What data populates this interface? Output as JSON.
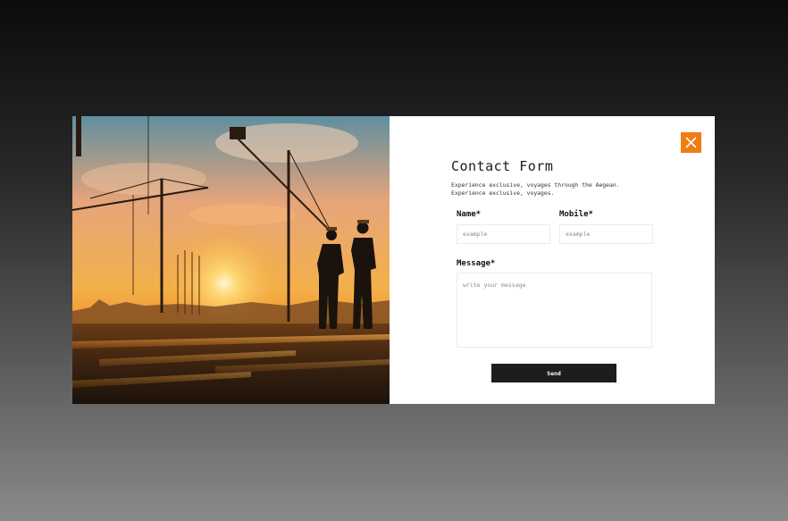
{
  "modal": {
    "image_alt": "construction site at sunset",
    "close_icon": "close-icon",
    "accent_color": "#ef7d12",
    "title": "Contact Form",
    "subtitle_line1": "Experience exclusive, voyages through the Aegean.",
    "subtitle_line2": "Experience exclusive, voyages.",
    "name": {
      "label": "Name*",
      "placeholder": "example",
      "value": ""
    },
    "mobile": {
      "label": "Mobile*",
      "placeholder": "example",
      "value": ""
    },
    "message": {
      "label": "Message*",
      "placeholder": "write your message",
      "value": ""
    },
    "send_label": "Send"
  }
}
